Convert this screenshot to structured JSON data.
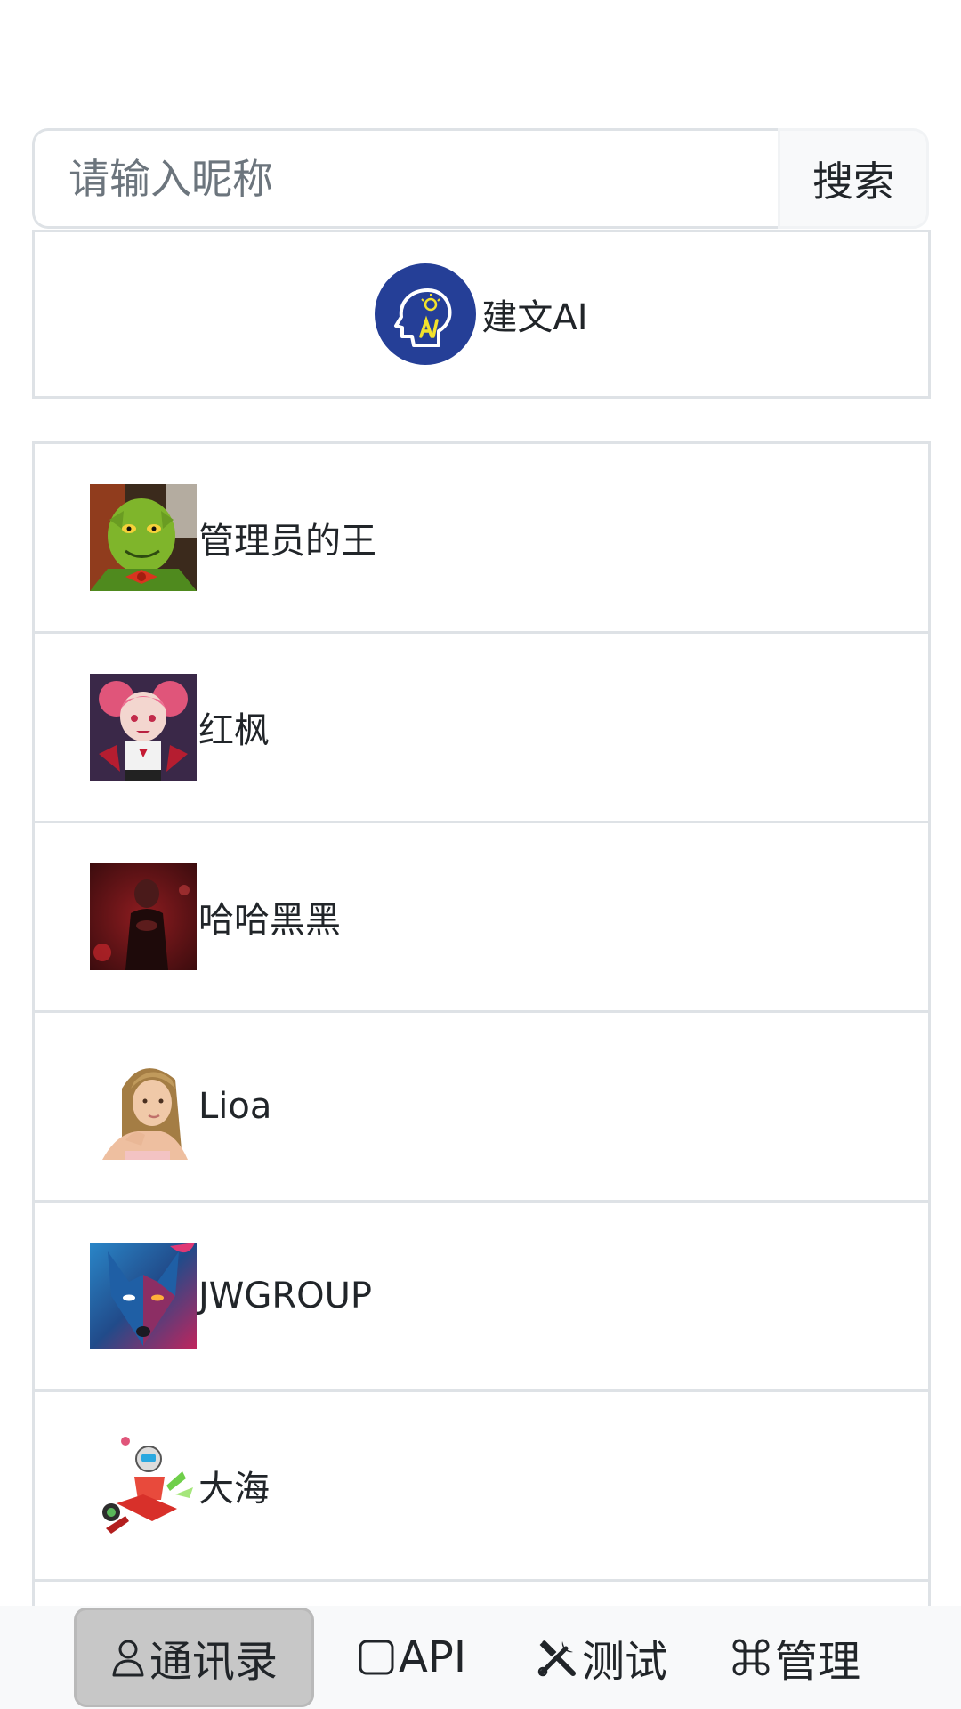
{
  "search": {
    "placeholder": "请输入昵称",
    "button_label": "搜索"
  },
  "ai_assistant": {
    "name": "建文AI",
    "avatar_icon": "head-lightbulb-ai-icon",
    "avatar_color": "#253f97",
    "accent_color": "#f2e22c"
  },
  "contacts": [
    {
      "name": "管理员的王",
      "avatar": "grinch-avatar"
    },
    {
      "name": "红枫",
      "avatar": "anime-girl-avatar"
    },
    {
      "name": "哈哈黑黑",
      "avatar": "red-portrait-avatar"
    },
    {
      "name": "Lioa",
      "avatar": "blonde-girl-avatar"
    },
    {
      "name": "JWGROUP",
      "avatar": "wolf-avatar"
    },
    {
      "name": "大海",
      "avatar": "robot-rider-avatar"
    }
  ],
  "bottom_nav": [
    {
      "label": "通讯录",
      "icon": "person-icon",
      "active": true
    },
    {
      "label": "API",
      "icon": "square-icon",
      "active": false
    },
    {
      "label": "测试",
      "icon": "tools-icon",
      "active": false
    },
    {
      "label": "管理",
      "icon": "command-icon",
      "active": false
    }
  ]
}
